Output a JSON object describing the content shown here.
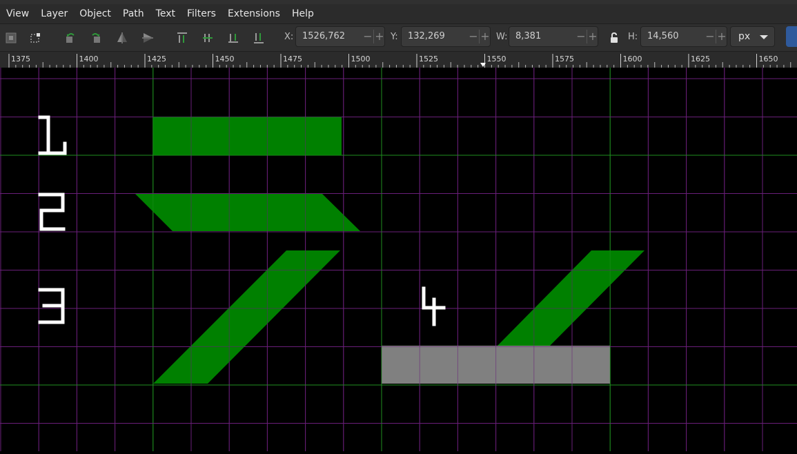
{
  "menu": [
    "View",
    "Layer",
    "Object",
    "Path",
    "Text",
    "Filters",
    "Extensions",
    "Help"
  ],
  "toolbar": {
    "icons": [
      "select-all-icon",
      "select-same-icon",
      "rotate-ccw-icon",
      "rotate-cw-icon",
      "flip-horizontal-icon",
      "flip-vertical-icon",
      "raise-to-top-icon",
      "raise-icon",
      "lower-icon",
      "lower-to-bottom-icon"
    ],
    "x_label": "X:",
    "x_value": "1526,762",
    "y_label": "Y:",
    "y_value": "132,269",
    "w_label": "W:",
    "w_value": "8,381",
    "h_label": "H:",
    "h_value": "14,560",
    "lock_icon": "lock-open-icon",
    "unit": "px"
  },
  "ruler": {
    "labels": [
      "1375",
      "1400",
      "1425",
      "1450",
      "1475",
      "1500",
      "1525",
      "1550",
      "1575",
      "1600",
      "1625",
      "1650"
    ]
  },
  "canvas": {
    "numbers": [
      "1",
      "2",
      "3",
      "4"
    ],
    "colors": {
      "shape_green": "#008000",
      "shape_gray": "#808080",
      "grid_major": "#1f8f1f",
      "grid_minor": "#6a1f7a",
      "label": "#ffffff"
    }
  }
}
